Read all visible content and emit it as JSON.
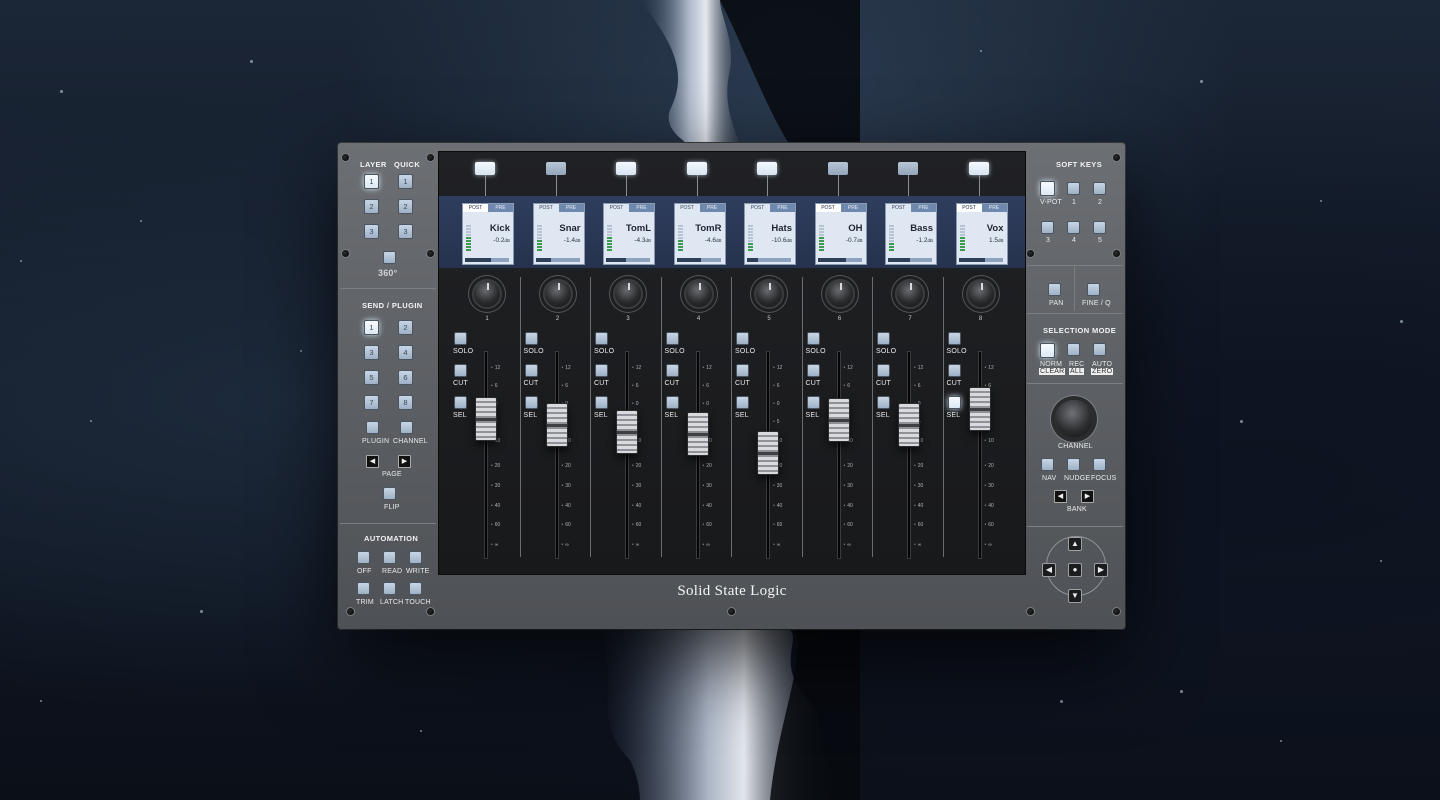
{
  "brand": "Solid State Logic",
  "left_panel": {
    "layer_label": "LAYER",
    "quick_label": "QUICK",
    "layer_buttons": [
      "1",
      "2",
      "3"
    ],
    "quick_buttons": [
      "1",
      "2",
      "3"
    ],
    "mode_360_label": "360°",
    "send_plugin_label": "SEND / PLUGIN",
    "send_buttons": [
      "1",
      "2",
      "3",
      "4",
      "5",
      "6",
      "7",
      "8"
    ],
    "plugin_label": "PLUGIN",
    "channel_label": "CHANNEL",
    "page_label": "PAGE",
    "flip_label": "FLIP",
    "automation_label": "AUTOMATION",
    "automation_buttons": [
      "OFF",
      "READ",
      "WRITE",
      "TRIM",
      "LATCH",
      "TOUCH"
    ]
  },
  "channels": [
    {
      "name": "Kick",
      "gain": "-0.2",
      "unit": "dB",
      "post": "POST",
      "pre": "PRE",
      "number": "1",
      "fader_level": 0.66,
      "meter_level": 0.6,
      "bar": 0.6
    },
    {
      "name": "Snar",
      "gain": "-1.4",
      "unit": "dB",
      "post": "POST",
      "pre": "PRE",
      "number": "2",
      "fader_level": 0.62,
      "meter_level": 0.4,
      "bar": 0.35
    },
    {
      "name": "TomL",
      "gain": "-4.3",
      "unit": "dB",
      "post": "POST",
      "pre": "PRE",
      "number": "3",
      "fader_level": 0.58,
      "meter_level": 0.5,
      "bar": 0.45
    },
    {
      "name": "TomR",
      "gain": "-4.6",
      "unit": "dB",
      "post": "POST",
      "pre": "PRE",
      "number": "4",
      "fader_level": 0.57,
      "meter_level": 0.45,
      "bar": 0.55
    },
    {
      "name": "Hats",
      "gain": "-10.6",
      "unit": "dB",
      "post": "POST",
      "pre": "PRE",
      "number": "5",
      "fader_level": 0.45,
      "meter_level": 0.35,
      "bar": 0.25
    },
    {
      "name": "OH",
      "gain": "-0.7",
      "unit": "dB",
      "post": "POST",
      "pre": "PRE",
      "number": "6",
      "fader_level": 0.65,
      "meter_level": 0.55,
      "bar": 0.65
    },
    {
      "name": "Bass",
      "gain": "-1.2",
      "unit": "dB",
      "post": "POST",
      "pre": "PRE",
      "number": "7",
      "fader_level": 0.62,
      "meter_level": 0.3,
      "bar": 0.5
    },
    {
      "name": "Vox",
      "gain": "1.5",
      "unit": "dB",
      "post": "POST",
      "pre": "PRE",
      "number": "8",
      "fader_level": 0.72,
      "meter_level": 0.5,
      "bar": 0.6
    }
  ],
  "channel_buttons": {
    "solo": "SOLO",
    "cut": "CUT",
    "sel": "SEL"
  },
  "fader_scale": [
    "12",
    "6",
    "0",
    "5",
    "10",
    "20",
    "30",
    "40",
    "60",
    "∞"
  ],
  "right_panel": {
    "soft_keys_label": "SOFT KEYS",
    "vpot_label": "V-POT",
    "soft_key_numbers": [
      "1",
      "2",
      "3",
      "4",
      "5"
    ],
    "pan_label": "PAN",
    "fine_label": "FINE / Q",
    "selection_mode_label": "SELECTION MODE",
    "norm_label": "NORM",
    "clear_label": "CLEAR",
    "rec_label": "REC",
    "all_label": "ALL",
    "auto_label": "AUTO",
    "zero_label": "ZERO",
    "channel_label": "CHANNEL",
    "nav_label": "NAV",
    "nudge_label": "NUDGE",
    "focus_label": "FOCUS",
    "bank_label": "BANK"
  },
  "colors": {
    "lcd_bg": "#dfe7f2",
    "lcd_strip": "#2f3d5e",
    "meter_green": "#3c9a54",
    "button_blue": "#c7d6e6"
  }
}
